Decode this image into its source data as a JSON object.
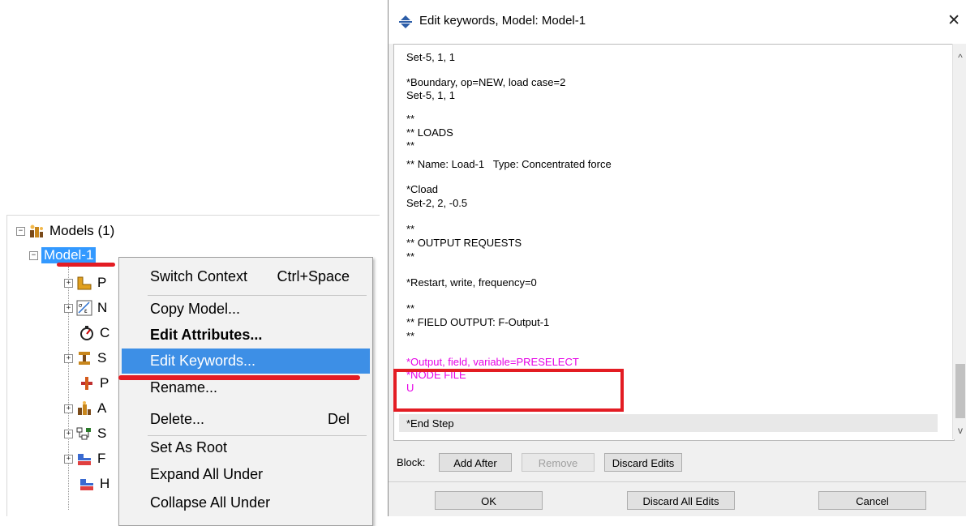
{
  "tree": {
    "root_label": "Models (1)",
    "model_label": "Model-1",
    "children": [
      {
        "letter": "P",
        "icon": "parts-icon"
      },
      {
        "letter": "N",
        "icon": "materials-icon"
      },
      {
        "letter": "C",
        "icon": "calibrations-icon"
      },
      {
        "letter": "S",
        "icon": "sections-icon"
      },
      {
        "letter": "P",
        "icon": "profiles-icon"
      },
      {
        "letter": "A",
        "icon": "assembly-icon"
      },
      {
        "letter": "S",
        "icon": "steps-icon"
      },
      {
        "letter": "F",
        "icon": "field-output-icon"
      },
      {
        "letter": "H",
        "icon": "history-output-icon"
      }
    ]
  },
  "menu": {
    "items": [
      {
        "label": "Switch Context",
        "shortcut": "Ctrl+Space"
      },
      {
        "label": "Copy Model...",
        "shortcut": ""
      },
      {
        "label": "Edit Attributes...",
        "shortcut": ""
      },
      {
        "label": "Edit Keywords...",
        "shortcut": ""
      },
      {
        "label": "Rename...",
        "shortcut": ""
      },
      {
        "label": "Delete...",
        "shortcut": "Del"
      },
      {
        "label": "Set As Root",
        "shortcut": ""
      },
      {
        "label": "Expand All Under",
        "shortcut": ""
      },
      {
        "label": "Collapse All Under",
        "shortcut": ""
      }
    ]
  },
  "dialog": {
    "title": "Edit keywords, Model: Model-1",
    "lines": [
      "Set-5, 1, 1",
      "*Boundary, op=NEW, load case=2",
      "Set-5, 1, 1",
      "**",
      "** LOADS",
      "**",
      "** Name: Load-1   Type: Concentrated force",
      "*Cload",
      "Set-2, 2, -0.5",
      "**",
      "** OUTPUT REQUESTS",
      "**",
      "*Restart, write, frequency=0",
      "**",
      "** FIELD OUTPUT: F-Output-1",
      "**",
      "*Output, field, variable=PRESELECT",
      "*NODE FILE",
      "U",
      "*End Step"
    ],
    "block_label": "Block:",
    "buttons": {
      "add_after": "Add After",
      "remove": "Remove",
      "discard_edits": "Discard Edits",
      "ok": "OK",
      "discard_all": "Discard All Edits",
      "cancel": "Cancel"
    }
  },
  "colors": {
    "selection": "#3399ff",
    "menu_highlight": "#3d8fe6",
    "annotation_red": "#e31c23",
    "edited_text": "#e600e6"
  }
}
